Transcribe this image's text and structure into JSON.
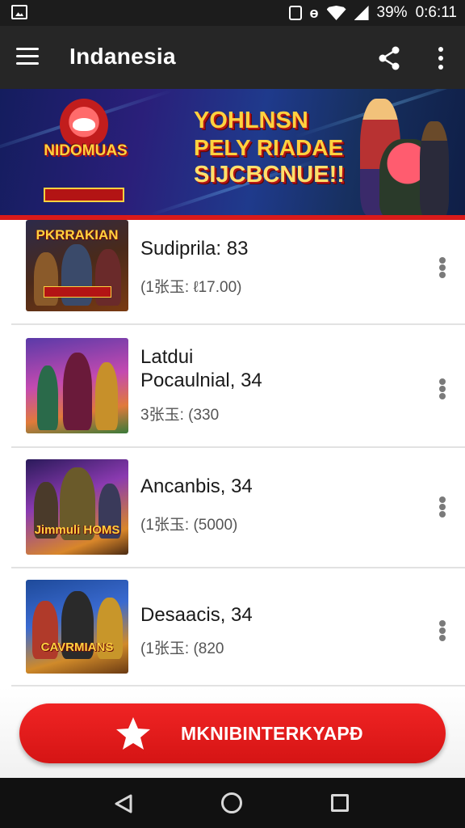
{
  "status_bar": {
    "battery": "39%",
    "time": "0:6:11",
    "icons": [
      "gallery-icon",
      "vibrate-icon",
      "nfc-icon",
      "wifi-icon",
      "signal-icon"
    ]
  },
  "app_bar": {
    "title": "Indanesia",
    "icons": [
      "menu-icon",
      "share-icon",
      "more-vert-icon"
    ]
  },
  "banner": {
    "logo_text": "NIDOMUAS",
    "headline_lines": [
      "YOHLNSN",
      "PELY RIADAE",
      "SIJCBCNUE!!"
    ],
    "accent_color": "#d91a1a"
  },
  "list": [
    {
      "thumb_caption": "PKRRAKIAN",
      "title_lines": [
        "Sudiprila: 83"
      ],
      "subtitle": "(1张玉: ℓ17.00)"
    },
    {
      "thumb_caption": "",
      "title_lines": [
        "Latdui",
        "Pocaulnial, 34"
      ],
      "subtitle": "3张玉: (330"
    },
    {
      "thumb_caption": "Jimmuli HOMS",
      "title_lines": [
        "Ancanbis, 34"
      ],
      "subtitle": "(1张玉: (5000)"
    },
    {
      "thumb_caption": "CAVRMIANS",
      "title_lines": [
        "Desaacis, 34"
      ],
      "subtitle": "(1张玉: (820"
    }
  ],
  "cta": {
    "label": "MKNIBINTERKYAPÐ",
    "color": "#e61b1b"
  },
  "nav_bar": {
    "icons": [
      "back-icon",
      "home-icon",
      "recents-icon"
    ]
  }
}
